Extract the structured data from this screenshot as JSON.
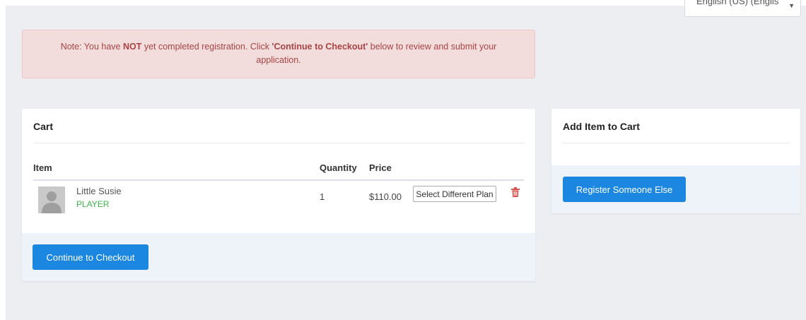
{
  "language": {
    "selected": "English (US) (Englis"
  },
  "alert": {
    "prefix": "Note: You have ",
    "emphasis": "NOT",
    "middle": " yet completed registration. Click ",
    "link_text": "'Continue to Checkout'",
    "suffix": " below to review and submit your application."
  },
  "cart": {
    "title": "Cart",
    "columns": {
      "item": "Item",
      "quantity": "Quantity",
      "price": "Price"
    },
    "items": [
      {
        "name": "Little Susie",
        "role": "PLAYER",
        "quantity": "1",
        "price": "$110.00",
        "action_label": "Select Different Plan"
      }
    ],
    "checkout_label": "Continue to Checkout"
  },
  "add_item": {
    "title": "Add Item to Cart",
    "register_label": "Register Someone Else"
  },
  "colors": {
    "primary": "#1b87e0",
    "alert_bg": "#f2dcdc",
    "alert_text": "#a94442",
    "role_green": "#3bb54a",
    "delete_red": "#d9534f"
  }
}
